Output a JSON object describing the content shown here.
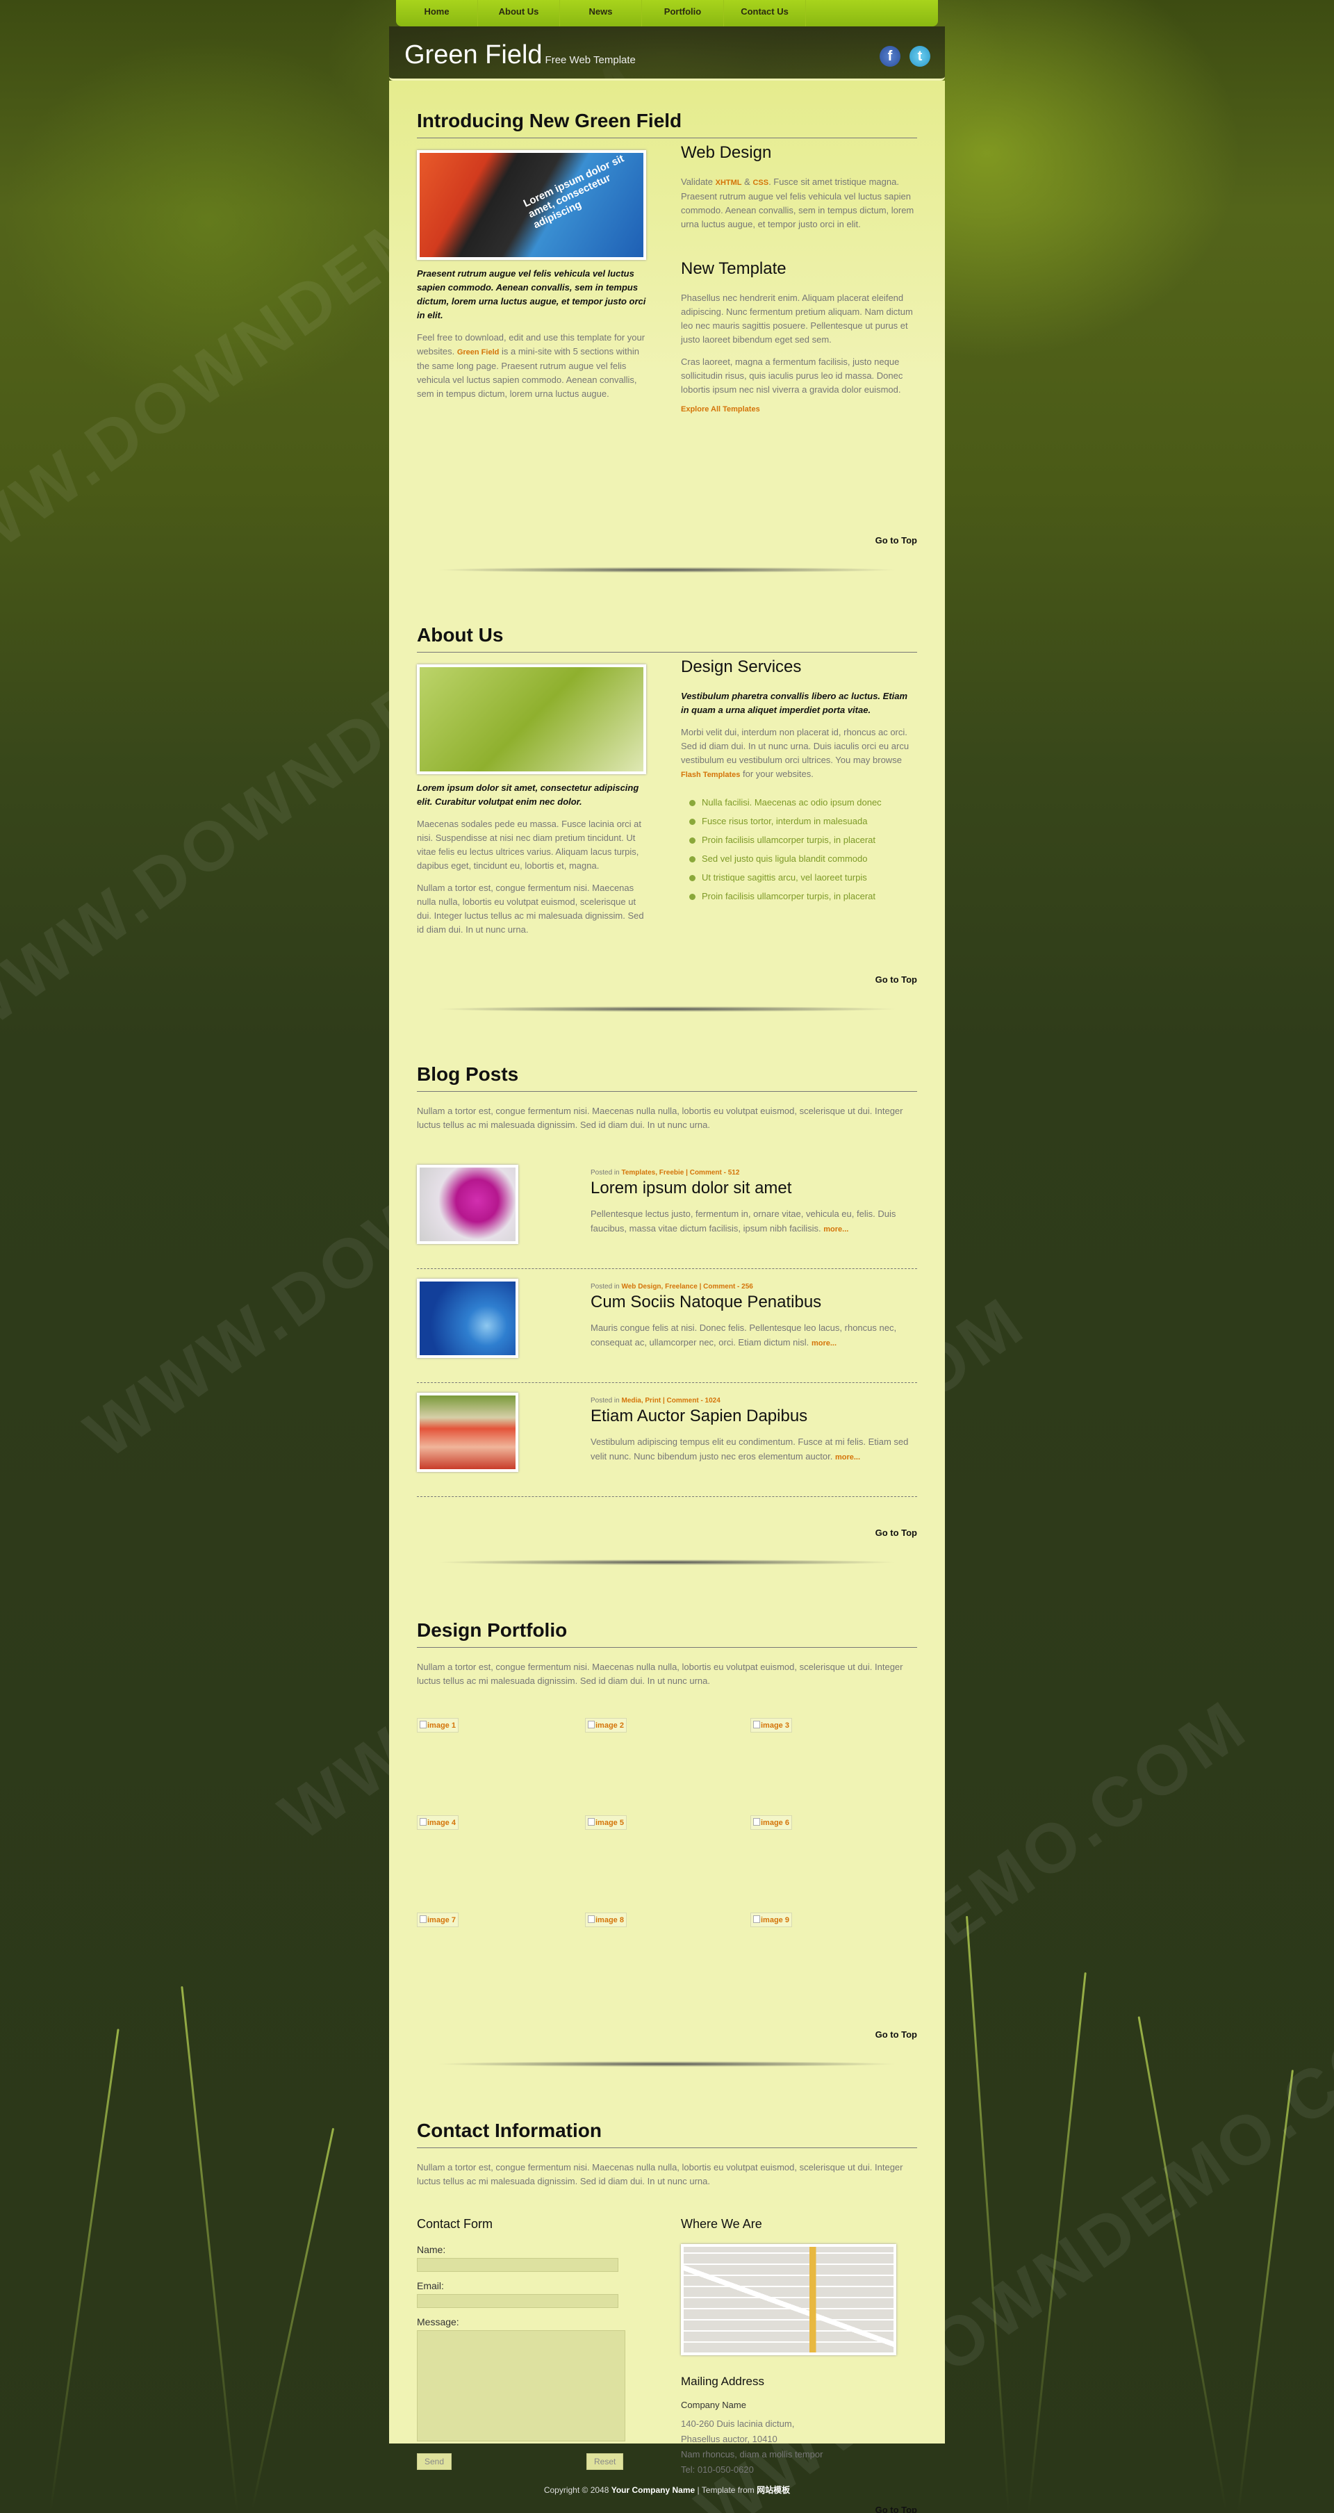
{
  "nav": [
    {
      "label": "Home"
    },
    {
      "label": "About Us"
    },
    {
      "label": "News"
    },
    {
      "label": "Portfolio"
    },
    {
      "label": "Contact Us"
    }
  ],
  "header": {
    "title": "Green Field",
    "tagline": "Free Web Template",
    "facebook": "f",
    "twitter": "t"
  },
  "watermark": "WWW.DOWNDEMO.COM",
  "intro": {
    "title": "Introducing New Green Field",
    "image_text": "Lorem ipsum dolor sit amet, consectetur adipiscing",
    "caption": "Praesent rutrum augue vel felis vehicula vel luctus sapien commodo. Aenean convallis, sem in tempus dictum, lorem urna luctus augue, et tempor justo orci in elit.",
    "p1_a": "Feel free to download, edit and use this template for your websites.",
    "p1_hl": "Green Field",
    "p1_b": "is a mini-site with 5 sections within the same long page. Praesent rutrum augue vel felis vehicula vel luctus sapien commodo. Aenean convallis, sem in tempus dictum, lorem urna luctus augue.",
    "web_design_title": "Web Design",
    "wd_a": "Validate",
    "wd_xhtml": "XHTML",
    "wd_amp": "&",
    "wd_css": "CSS",
    "wd_b": ". Fusce sit amet tristique magna. Praesent rutrum augue vel felis vehicula vel luctus sapien commodo. Aenean convallis, sem in tempus dictum, lorem urna luctus augue, et tempor justo orci in elit.",
    "new_template_title": "New Template",
    "nt_p1": "Phasellus nec hendrerit enim. Aliquam placerat eleifend adipiscing. Nunc fermentum pretium aliquam. Nam dictum leo nec mauris sagittis posuere. Pellentesque ut purus et justo laoreet bibendum eget sed sem.",
    "nt_p2": "Cras laoreet, magna a fermentum facilisis, justo neque sollicitudin risus, quis iaculis purus leo id massa. Donec lobortis ipsum nec nisl viverra a gravida dolor euismod.",
    "explore": "Explore All Templates",
    "goto": "Go to Top"
  },
  "about": {
    "title": "About Us",
    "caption": "Lorem ipsum dolor sit amet, consectetur adipiscing elit. Curabitur volutpat enim nec dolor.",
    "p1": "Maecenas sodales pede eu massa. Fusce lacinia orci at nisi. Suspendisse at nisi nec diam pretium tincidunt. Ut vitae felis eu lectus ultrices varius. Aliquam lacus turpis, dapibus eget, tincidunt eu, lobortis et, magna.",
    "p2": "Nullam a tortor est, congue fermentum nisi. Maecenas nulla nulla, lobortis eu volutpat euismod, scelerisque ut dui. Integer luctus tellus ac mi malesuada dignissim. Sed id diam dui. In ut nunc urna.",
    "ds_title": "Design Services",
    "ds_caption": "Vestibulum pharetra convallis libero ac luctus. Etiam in quam a urna aliquet imperdiet porta vitae.",
    "ds_p_a": "Morbi velit dui, interdum non placerat id, rhoncus ac orci. Sed id diam dui. In ut nunc urna. Duis iaculis orci eu arcu vestibulum eu vestibulum orci ultrices. You may browse",
    "ds_hl": "Flash Templates",
    "ds_p_b": "for your websites.",
    "bullets": [
      {
        "text": "Nulla facilisi. Maecenas ac odio ipsum donec"
      },
      {
        "text": "Fusce risus tortor, interdum in malesuada"
      },
      {
        "text": "Proin facilisis ullamcorper turpis, in placerat"
      },
      {
        "text": "Sed vel justo quis ligula blandit commodo"
      },
      {
        "text": "Ut tristique sagittis arcu, vel laoreet turpis"
      },
      {
        "text": "Proin facilisis ullamcorper turpis, in placerat"
      }
    ],
    "goto": "Go to Top"
  },
  "blog": {
    "title": "Blog Posts",
    "intro": "Nullam a tortor est, congue fermentum nisi. Maecenas nulla nulla, lobortis eu volutpat euismod, scelerisque ut dui. Integer luctus tellus ac mi malesuada dignissim. Sed id diam dui. In ut nunc urna.",
    "posts": [
      {
        "posted": "Posted in",
        "cats": "Templates, Freebie",
        "sep": "|",
        "comments": "Comment - 512",
        "title": "Lorem ipsum dolor sit amet",
        "text": "Pellentesque lectus justo, fermentum in, ornare vitae, vehicula eu, felis. Duis faucibus, massa vitae dictum facilisis, ipsum nibh facilisis.",
        "more": "more..."
      },
      {
        "posted": "Posted in",
        "cats": "Web Design, Freelance",
        "sep": "|",
        "comments": "Comment - 256",
        "title": "Cum Sociis Natoque Penatibus",
        "text": "Mauris congue felis at nisi. Donec felis. Pellentesque leo lacus, rhoncus nec, consequat ac, ullamcorper nec, orci. Etiam dictum nisl.",
        "more": "more..."
      },
      {
        "posted": "Posted in",
        "cats": "Media, Print",
        "sep": "|",
        "comments": "Comment - 1024",
        "title": "Etiam Auctor Sapien Dapibus",
        "text": "Vestibulum adipiscing tempus elit eu condimentum. Fusce at mi felis. Etiam sed velit nunc. Nunc bibendum justo nec eros elementum auctor.",
        "more": "more..."
      }
    ],
    "goto": "Go to Top"
  },
  "portfolio": {
    "title": "Design Portfolio",
    "intro": "Nullam a tortor est, congue fermentum nisi. Maecenas nulla nulla, lobortis eu volutpat euismod, scelerisque ut dui. Integer luctus tellus ac mi malesuada dignissim. Sed id diam dui. In ut nunc urna.",
    "images": [
      {
        "alt": "image 1"
      },
      {
        "alt": "image 2"
      },
      {
        "alt": "image 3"
      },
      {
        "alt": "image 4"
      },
      {
        "alt": "image 5"
      },
      {
        "alt": "image 6"
      },
      {
        "alt": "image 7"
      },
      {
        "alt": "image 8"
      },
      {
        "alt": "image 9"
      }
    ],
    "goto": "Go to Top"
  },
  "contact": {
    "title": "Contact Information",
    "intro": "Nullam a tortor est, congue fermentum nisi. Maecenas nulla nulla, lobortis eu volutpat euismod, scelerisque ut dui. Integer luctus tellus ac mi malesuada dignissim. Sed id diam dui. In ut nunc urna.",
    "form_title": "Contact Form",
    "name_label": "Name:",
    "email_label": "Email:",
    "message_label": "Message:",
    "send": "Send",
    "reset": "Reset",
    "where_title": "Where We Are",
    "mailing_title": "Mailing Address",
    "company": "Company Name",
    "address_lines": [
      {
        "text": "140-260 Duis lacinia dictum,"
      },
      {
        "text": "Phasellus auctor, 10410"
      },
      {
        "text": "Nam rhoncus, diam a mollis tempor"
      },
      {
        "text": "Tel: 010-050-0620"
      }
    ],
    "goto": "Go to Top"
  },
  "footer": {
    "copy": "Copyright © 2048",
    "company": "Your Company Name",
    "sep": "| Template from",
    "source": "网站模板"
  },
  "colors": {
    "accent": "#d4740a",
    "content_bg": "#f0f3b4",
    "nav": "#9cc41a"
  }
}
